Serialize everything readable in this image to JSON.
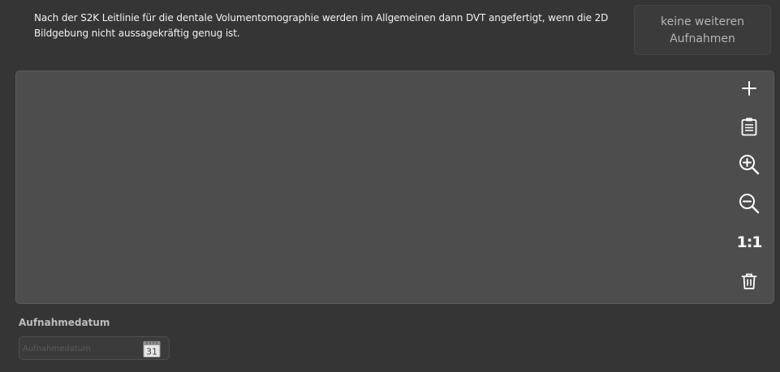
{
  "info": {
    "text": "Nach der S2K Leitlinie für die dentale Volumentomographie werden im Allgemeinen dann DVT angefertigt, wenn die 2D Bildgebung nicht aussagekräftig genug ist."
  },
  "no_more_button": {
    "label": "keine weiteren Aufnahmen"
  },
  "toolbar": {
    "tools": [
      {
        "name": "add",
        "icon": "plus-icon"
      },
      {
        "name": "paste",
        "icon": "clipboard-icon"
      },
      {
        "name": "zoom-in",
        "icon": "zoom-in-icon"
      },
      {
        "name": "zoom-out",
        "icon": "zoom-out-icon"
      },
      {
        "name": "actual-size",
        "icon": "one-to-one-icon",
        "label": "1:1"
      },
      {
        "name": "delete",
        "icon": "trash-icon"
      }
    ]
  },
  "date": {
    "label": "Aufnahmedatum",
    "placeholder": "Aufnahmedatum",
    "value": "",
    "calendar_icon": "calendar-icon",
    "calendar_day": "31"
  },
  "colors": {
    "background": "#353535",
    "panel": "#4d4d4d",
    "button_bg": "#3b3b3b",
    "icon": "#ffffff"
  }
}
